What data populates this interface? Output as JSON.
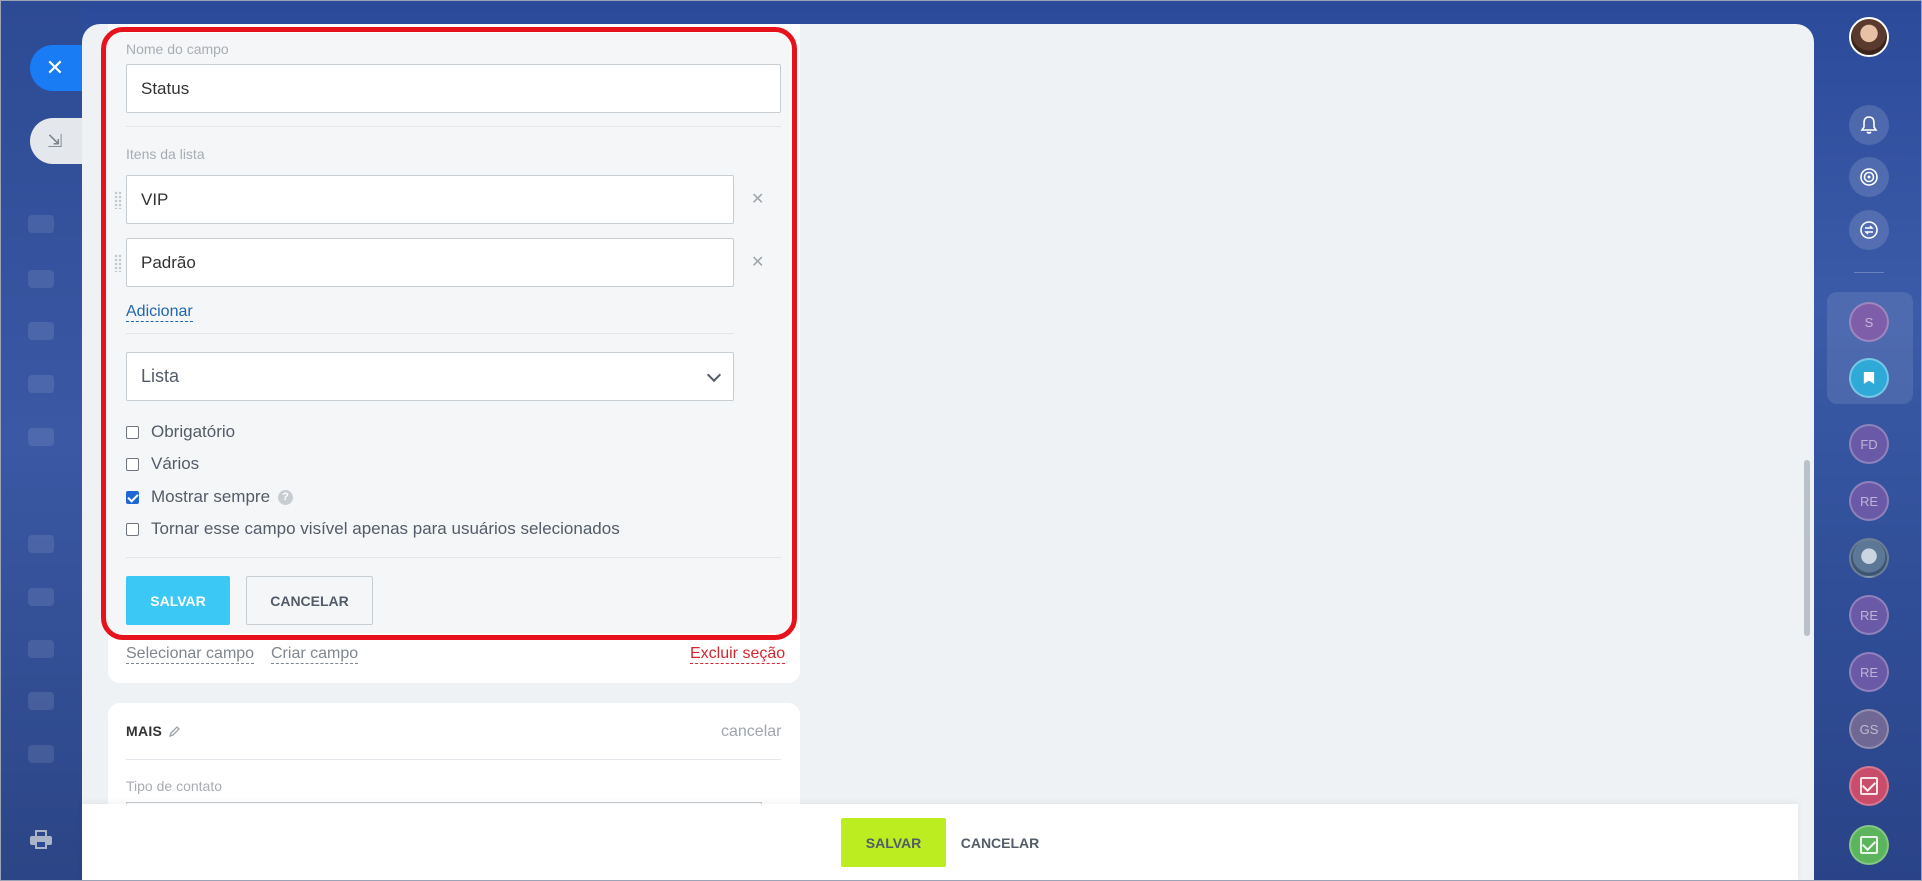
{
  "field_editor": {
    "field_name_label": "Nome do campo",
    "field_name_value": "Status",
    "list_items_label": "Itens da lista",
    "list_items": [
      {
        "value": "VIP"
      },
      {
        "value": "Padrão"
      }
    ],
    "add_link": "Adicionar",
    "field_type": "Lista",
    "options": [
      {
        "label": "Obrigatório",
        "checked": false
      },
      {
        "label": "Vários",
        "checked": false
      },
      {
        "label": "Mostrar sempre",
        "checked": true
      },
      {
        "label": "Tornar esse campo visível apenas para usuários selecionados",
        "checked": false
      }
    ],
    "help_glyph": "?",
    "save_label": "SALVAR",
    "cancel_label": "CANCELAR"
  },
  "section_footer": {
    "select_field": "Selecionar campo",
    "create_field": "Criar campo",
    "delete_section": "Excluir seção"
  },
  "mais_section": {
    "title": "MAIS",
    "cancel": "cancelar",
    "contact_type_label": "Tipo de contato"
  },
  "bottom_bar": {
    "save_label": "SALVAR",
    "cancel_label": "CANCELAR"
  },
  "right_rail": {
    "avatars": [
      "S",
      "FD",
      "RE",
      "RE",
      "RE",
      "GS"
    ]
  },
  "colors": {
    "highlight_frame": "#e8121c",
    "primary_save": "#3bc8f5",
    "page_save": "#bbed21",
    "close_button": "#1a7cf5",
    "link": "#2067b0",
    "danger": "#d3262e"
  },
  "icons": [
    "close-icon",
    "collapse-icon",
    "print-icon",
    "bell-icon",
    "target-icon",
    "sync-icon",
    "bookmark-icon",
    "drag-handle-icon",
    "remove-icon",
    "chevron-down-icon",
    "help-icon",
    "pencil-icon",
    "check-icon"
  ]
}
